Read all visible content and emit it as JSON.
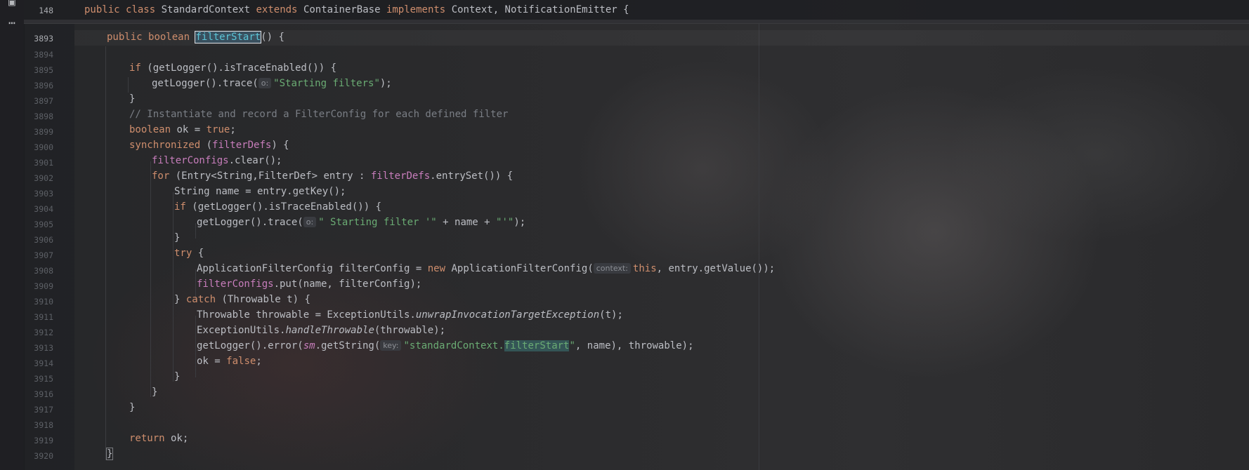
{
  "sticky": {
    "line_number": "148",
    "kw_public": "public",
    "kw_class": "class",
    "class_name": "StandardContext",
    "kw_extends": "extends",
    "super_class": "ContainerBase",
    "kw_implements": "implements",
    "interfaces": "Context, NotificationEmitter {"
  },
  "method_line_number": "3893",
  "line_numbers": [
    "3894",
    "3895",
    "3896",
    "3897",
    "3898",
    "3899",
    "3900",
    "3901",
    "3902",
    "3903",
    "3904",
    "3905",
    "3906",
    "3907",
    "3908",
    "3909",
    "3910",
    "3911",
    "3912",
    "3913",
    "3914",
    "3915",
    "3916",
    "3917",
    "3918",
    "3919",
    "3920"
  ],
  "code": {
    "method_public": "public",
    "method_boolean": "boolean",
    "method_name": "filterStart",
    "method_rest": "() {",
    "l3895_if": "if",
    "l3895_rest": " (getLogger().isTraceEnabled()) {",
    "l3896_call": "getLogger().trace(",
    "hint_o": "o:",
    "l3896_str": "\"Starting filters\"",
    "l3896_end": ");",
    "l3897": "}",
    "l3898_comment": "// Instantiate and record a FilterConfig for each defined filter",
    "l3899_boolean": "boolean",
    "l3899_mid": " ok = ",
    "l3899_true": "true",
    "l3899_end": ";",
    "l3900_sync": "synchronized",
    "l3900_open": " (",
    "l3900_field": "filterDefs",
    "l3900_end": ") {",
    "l3901_field": "filterConfigs",
    "l3901_end": ".clear();",
    "l3902_for": "for",
    "l3902_mid": " (Entry<String,FilterDef> entry : ",
    "l3902_field": "filterDefs",
    "l3902_end": ".entrySet()) {",
    "l3903": "String name = entry.getKey();",
    "l3904_if": "if",
    "l3904_rest": " (getLogger().isTraceEnabled()) {",
    "l3905_call": "getLogger().trace(",
    "l3905_str1": "\" Starting filter '\"",
    "l3905_mid": " + name + ",
    "l3905_str2": "\"'\"",
    "l3905_end": ");",
    "l3906": "}",
    "l3907_try": "try",
    "l3907_end": " {",
    "l3908_start": "ApplicationFilterConfig filterConfig = ",
    "l3908_new": "new",
    "l3908_mid": " ApplicationFilterConfig(",
    "hint_context": "context:",
    "l3908_this": "this",
    "l3908_end": ", entry.getValue());",
    "l3909_field": "filterConfigs",
    "l3909_end": ".put(name, filterConfig);",
    "l3910_open": "} ",
    "l3910_catch": "catch",
    "l3910_end": " (Throwable t) {",
    "l3911_start": "Throwable throwable = ExceptionUtils.",
    "l3911_method": "unwrapInvocationTargetException",
    "l3911_end": "(t);",
    "l3912_start": "ExceptionUtils.",
    "l3912_method": "handleThrowable",
    "l3912_end": "(throwable);",
    "l3913_start": "getLogger().error(",
    "l3913_sm": "sm",
    "l3913_get": ".getString(",
    "hint_key": "key:",
    "l3913_str1": "\"standardContext.",
    "l3913_match": "filterStart",
    "l3913_str2": "\"",
    "l3913_end": ", name), throwable);",
    "l3914_start": "ok = ",
    "l3914_false": "false",
    "l3914_end": ";",
    "l3915": "}",
    "l3916": "}",
    "l3917": "}",
    "l3919_return": "return",
    "l3919_end": " ok;",
    "l3920": "}"
  },
  "colors": {
    "background": "#262729",
    "keyword": "#cf8e6d",
    "field": "#c77dbb",
    "string": "#6aab73",
    "comment": "#7a7e85",
    "text": "#bcbec4"
  },
  "icons": [
    "project-icon",
    "more-icon"
  ]
}
